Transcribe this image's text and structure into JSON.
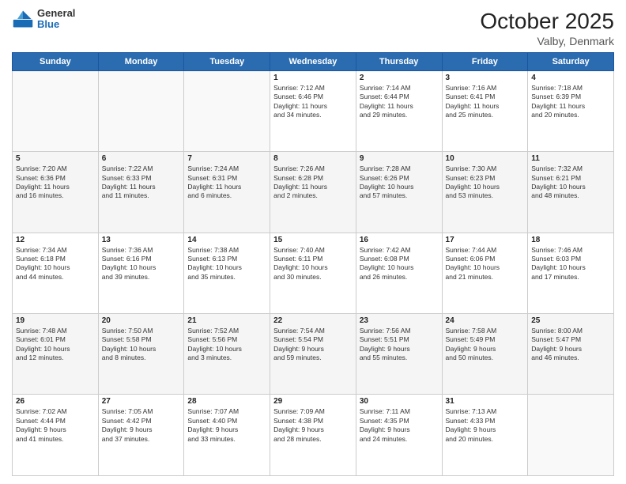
{
  "logo": {
    "line1": "General",
    "line2": "Blue"
  },
  "title": "October 2025",
  "location": "Valby, Denmark",
  "weekdays": [
    "Sunday",
    "Monday",
    "Tuesday",
    "Wednesday",
    "Thursday",
    "Friday",
    "Saturday"
  ],
  "weeks": [
    [
      {
        "day": "",
        "info": ""
      },
      {
        "day": "",
        "info": ""
      },
      {
        "day": "",
        "info": ""
      },
      {
        "day": "1",
        "info": "Sunrise: 7:12 AM\nSunset: 6:46 PM\nDaylight: 11 hours\nand 34 minutes."
      },
      {
        "day": "2",
        "info": "Sunrise: 7:14 AM\nSunset: 6:44 PM\nDaylight: 11 hours\nand 29 minutes."
      },
      {
        "day": "3",
        "info": "Sunrise: 7:16 AM\nSunset: 6:41 PM\nDaylight: 11 hours\nand 25 minutes."
      },
      {
        "day": "4",
        "info": "Sunrise: 7:18 AM\nSunset: 6:39 PM\nDaylight: 11 hours\nand 20 minutes."
      }
    ],
    [
      {
        "day": "5",
        "info": "Sunrise: 7:20 AM\nSunset: 6:36 PM\nDaylight: 11 hours\nand 16 minutes."
      },
      {
        "day": "6",
        "info": "Sunrise: 7:22 AM\nSunset: 6:33 PM\nDaylight: 11 hours\nand 11 minutes."
      },
      {
        "day": "7",
        "info": "Sunrise: 7:24 AM\nSunset: 6:31 PM\nDaylight: 11 hours\nand 6 minutes."
      },
      {
        "day": "8",
        "info": "Sunrise: 7:26 AM\nSunset: 6:28 PM\nDaylight: 11 hours\nand 2 minutes."
      },
      {
        "day": "9",
        "info": "Sunrise: 7:28 AM\nSunset: 6:26 PM\nDaylight: 10 hours\nand 57 minutes."
      },
      {
        "day": "10",
        "info": "Sunrise: 7:30 AM\nSunset: 6:23 PM\nDaylight: 10 hours\nand 53 minutes."
      },
      {
        "day": "11",
        "info": "Sunrise: 7:32 AM\nSunset: 6:21 PM\nDaylight: 10 hours\nand 48 minutes."
      }
    ],
    [
      {
        "day": "12",
        "info": "Sunrise: 7:34 AM\nSunset: 6:18 PM\nDaylight: 10 hours\nand 44 minutes."
      },
      {
        "day": "13",
        "info": "Sunrise: 7:36 AM\nSunset: 6:16 PM\nDaylight: 10 hours\nand 39 minutes."
      },
      {
        "day": "14",
        "info": "Sunrise: 7:38 AM\nSunset: 6:13 PM\nDaylight: 10 hours\nand 35 minutes."
      },
      {
        "day": "15",
        "info": "Sunrise: 7:40 AM\nSunset: 6:11 PM\nDaylight: 10 hours\nand 30 minutes."
      },
      {
        "day": "16",
        "info": "Sunrise: 7:42 AM\nSunset: 6:08 PM\nDaylight: 10 hours\nand 26 minutes."
      },
      {
        "day": "17",
        "info": "Sunrise: 7:44 AM\nSunset: 6:06 PM\nDaylight: 10 hours\nand 21 minutes."
      },
      {
        "day": "18",
        "info": "Sunrise: 7:46 AM\nSunset: 6:03 PM\nDaylight: 10 hours\nand 17 minutes."
      }
    ],
    [
      {
        "day": "19",
        "info": "Sunrise: 7:48 AM\nSunset: 6:01 PM\nDaylight: 10 hours\nand 12 minutes."
      },
      {
        "day": "20",
        "info": "Sunrise: 7:50 AM\nSunset: 5:58 PM\nDaylight: 10 hours\nand 8 minutes."
      },
      {
        "day": "21",
        "info": "Sunrise: 7:52 AM\nSunset: 5:56 PM\nDaylight: 10 hours\nand 3 minutes."
      },
      {
        "day": "22",
        "info": "Sunrise: 7:54 AM\nSunset: 5:54 PM\nDaylight: 9 hours\nand 59 minutes."
      },
      {
        "day": "23",
        "info": "Sunrise: 7:56 AM\nSunset: 5:51 PM\nDaylight: 9 hours\nand 55 minutes."
      },
      {
        "day": "24",
        "info": "Sunrise: 7:58 AM\nSunset: 5:49 PM\nDaylight: 9 hours\nand 50 minutes."
      },
      {
        "day": "25",
        "info": "Sunrise: 8:00 AM\nSunset: 5:47 PM\nDaylight: 9 hours\nand 46 minutes."
      }
    ],
    [
      {
        "day": "26",
        "info": "Sunrise: 7:02 AM\nSunset: 4:44 PM\nDaylight: 9 hours\nand 41 minutes."
      },
      {
        "day": "27",
        "info": "Sunrise: 7:05 AM\nSunset: 4:42 PM\nDaylight: 9 hours\nand 37 minutes."
      },
      {
        "day": "28",
        "info": "Sunrise: 7:07 AM\nSunset: 4:40 PM\nDaylight: 9 hours\nand 33 minutes."
      },
      {
        "day": "29",
        "info": "Sunrise: 7:09 AM\nSunset: 4:38 PM\nDaylight: 9 hours\nand 28 minutes."
      },
      {
        "day": "30",
        "info": "Sunrise: 7:11 AM\nSunset: 4:35 PM\nDaylight: 9 hours\nand 24 minutes."
      },
      {
        "day": "31",
        "info": "Sunrise: 7:13 AM\nSunset: 4:33 PM\nDaylight: 9 hours\nand 20 minutes."
      },
      {
        "day": "",
        "info": ""
      }
    ]
  ]
}
